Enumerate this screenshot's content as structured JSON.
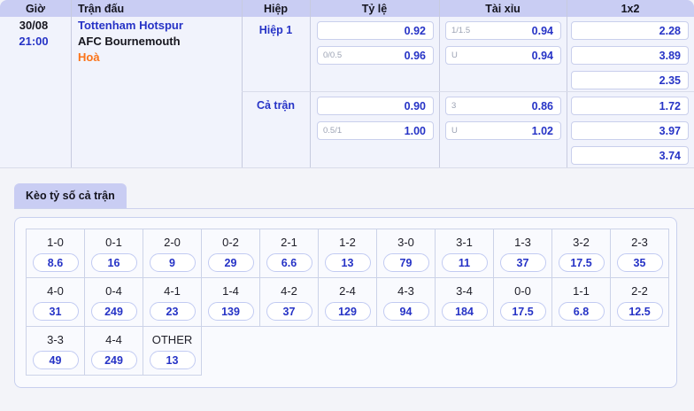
{
  "header": {
    "cols": [
      "Giờ",
      "Trận đấu",
      "Hiệp",
      "Tỷ lệ",
      "Tài xỉu",
      "1x2"
    ]
  },
  "match": {
    "date": "30/08",
    "time": "21:00",
    "home": "Tottenham Hotspur",
    "away": "AFC Bournemouth",
    "draw_label": "Hoà"
  },
  "sections": [
    {
      "period": "Hiệp 1",
      "handicap": [
        {
          "label": "",
          "odds": "0.92"
        },
        {
          "label": "0/0.5",
          "odds": "0.96"
        }
      ],
      "overunder": [
        {
          "label": "1/1.5",
          "odds": "0.94"
        },
        {
          "label": "U",
          "odds": "0.94"
        }
      ],
      "one_x_two": [
        "2.28",
        "3.89",
        "2.35"
      ]
    },
    {
      "period": "Cả trận",
      "handicap": [
        {
          "label": "",
          "odds": "0.90"
        },
        {
          "label": "0.5/1",
          "odds": "1.00"
        }
      ],
      "overunder": [
        {
          "label": "3",
          "odds": "0.86"
        },
        {
          "label": "U",
          "odds": "1.02"
        }
      ],
      "one_x_two": [
        "1.72",
        "3.97",
        "3.74"
      ]
    }
  ],
  "score_tab": {
    "label": "Kèo tỷ số cả trận"
  },
  "score_grid": {
    "rows": [
      [
        {
          "score": "1-0",
          "odds": "8.6"
        },
        {
          "score": "0-1",
          "odds": "16"
        },
        {
          "score": "2-0",
          "odds": "9"
        },
        {
          "score": "0-2",
          "odds": "29"
        },
        {
          "score": "2-1",
          "odds": "6.6"
        },
        {
          "score": "1-2",
          "odds": "13"
        },
        {
          "score": "3-0",
          "odds": "79"
        },
        {
          "score": "3-1",
          "odds": "11"
        },
        {
          "score": "1-3",
          "odds": "37"
        },
        {
          "score": "3-2",
          "odds": "17.5"
        },
        {
          "score": "2-3",
          "odds": "35"
        }
      ],
      [
        {
          "score": "4-0",
          "odds": "31"
        },
        {
          "score": "0-4",
          "odds": "249"
        },
        {
          "score": "4-1",
          "odds": "23"
        },
        {
          "score": "1-4",
          "odds": "139"
        },
        {
          "score": "4-2",
          "odds": "37"
        },
        {
          "score": "2-4",
          "odds": "129"
        },
        {
          "score": "4-3",
          "odds": "94"
        },
        {
          "score": "3-4",
          "odds": "184"
        },
        {
          "score": "0-0",
          "odds": "17.5"
        },
        {
          "score": "1-1",
          "odds": "6.8"
        },
        {
          "score": "2-2",
          "odds": "12.5"
        }
      ],
      [
        {
          "score": "3-3",
          "odds": "49"
        },
        {
          "score": "4-4",
          "odds": "249"
        },
        {
          "score": "OTHER",
          "odds": "13"
        }
      ]
    ]
  },
  "colors": {
    "header_bg": "#c9cdf3",
    "body_bg": "#f1f3fc",
    "page_bg": "#f3f4f9",
    "accent_blue": "#2633c6",
    "draw_orange": "#fb7318",
    "box_border": "#c9cfec",
    "grid_border": "#ccd3e8"
  }
}
